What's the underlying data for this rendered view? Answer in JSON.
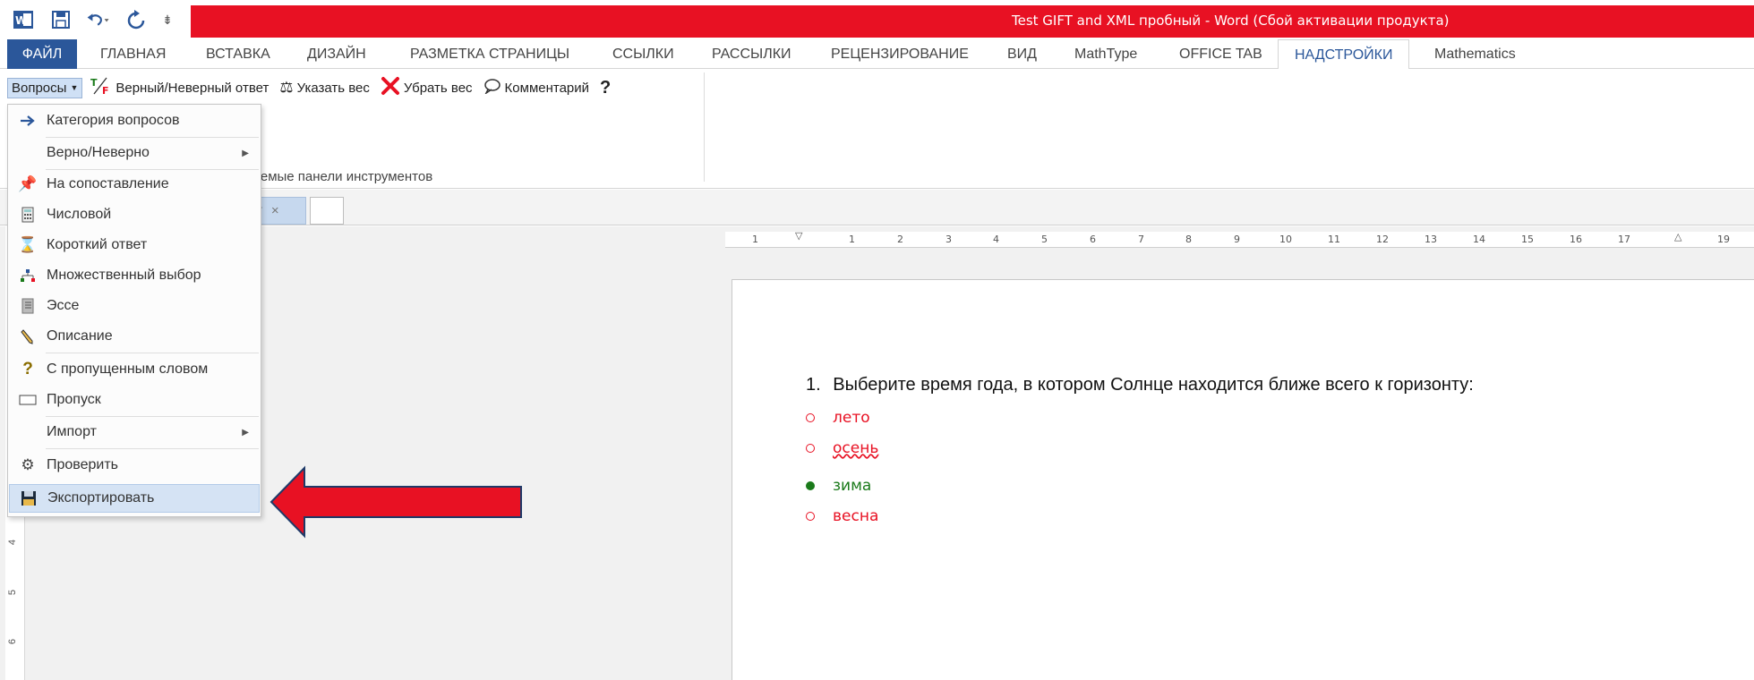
{
  "titlebar": {
    "title": "Test GIFT and XML пробный -  Word (Сбой активации продукта)",
    "color": "#e81123"
  },
  "quick_access": {
    "icons": [
      "word-icon",
      "save-icon",
      "undo-icon",
      "redo-icon",
      "customize-icon"
    ],
    "customize_glyph": "⇟"
  },
  "ribbon_tabs": [
    {
      "label": "ФАЙЛ"
    },
    {
      "label": "ГЛАВНАЯ"
    },
    {
      "label": "ВСТАВКА"
    },
    {
      "label": "ДИЗАЙН"
    },
    {
      "label": "РАЗМЕТКА СТРАНИЦЫ"
    },
    {
      "label": "ССЫЛКИ"
    },
    {
      "label": "РАССЫЛКИ"
    },
    {
      "label": "РЕЦЕНЗИРОВАНИЕ"
    },
    {
      "label": "ВИД"
    },
    {
      "label": "MathType"
    },
    {
      "label": "OFFICE TAB"
    },
    {
      "label": "НАДСТРОЙКИ",
      "active": true
    },
    {
      "label": "Mathematics"
    }
  ],
  "ribbon": {
    "voprosy": "Вопросы",
    "true_false": "Верный/Неверный ответ",
    "set_weight": "Указать вес",
    "remove_weight": "Убрать вес",
    "comment": "Комментарий",
    "group_label": "аиваемые панели инструментов"
  },
  "document_tab": {
    "label": "*",
    "close": "×"
  },
  "menu": {
    "items": [
      {
        "label": "Категория вопросов",
        "icon": "arrow-right-icon"
      },
      {
        "label": "Верно/Неверно",
        "submenu": true
      },
      {
        "label": "На сопоставление",
        "icon": "pin-icon"
      },
      {
        "label": "Числовой",
        "icon": "calculator-icon"
      },
      {
        "label": "Короткий ответ",
        "icon": "hourglass-icon"
      },
      {
        "label": "Множественный выбор",
        "icon": "hierarchy-icon"
      },
      {
        "label": "Эссе",
        "icon": "notebook-icon"
      },
      {
        "label": "Описание",
        "icon": "pencil-icon"
      },
      {
        "label": "С пропущенным словом",
        "icon": "question-icon"
      },
      {
        "label": "Пропуск",
        "icon": "blank-rect-icon"
      },
      {
        "label": "Импорт",
        "submenu": true
      },
      {
        "label": "Проверить",
        "icon": "gears-icon"
      },
      {
        "label": "Экспортировать",
        "icon": "floppy-icon",
        "highlighted": true
      }
    ]
  },
  "rulers": {
    "horizontal": [
      "1",
      "1",
      "2",
      "3",
      "4",
      "5",
      "6",
      "7",
      "8",
      "9",
      "10",
      "11",
      "12",
      "13",
      "14",
      "15",
      "16",
      "17",
      "19"
    ],
    "vertical": [
      "4",
      "5",
      "6"
    ]
  },
  "document": {
    "question_number": "1.",
    "question": "Выберите время года, в котором Солнце находится ближе всего к горизонту:",
    "answers": [
      {
        "text": "лето",
        "correct": false
      },
      {
        "text": "осень",
        "correct": false,
        "spellcheck": true
      },
      {
        "text": "зима",
        "correct": true
      },
      {
        "text": "весна",
        "correct": false
      }
    ]
  },
  "colors": {
    "accent": "#2b579a",
    "wrong": "#e81123",
    "correct": "#1a7a1a",
    "arrow": "#e81123"
  }
}
